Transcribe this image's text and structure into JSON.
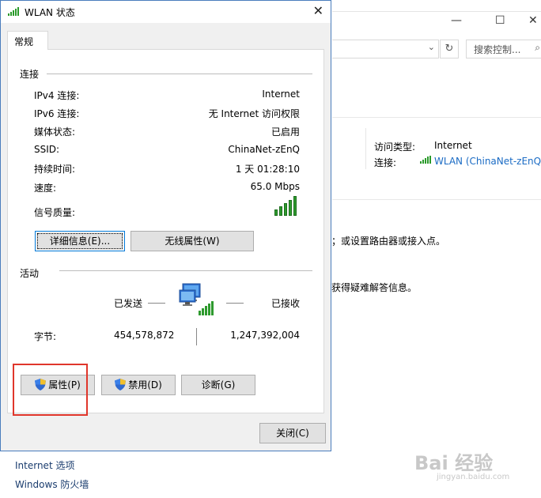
{
  "background": {
    "address_dropdown": "⌄",
    "refresh_icon": "↻",
    "search_placeholder": "搜索控制...",
    "access_type_label": "访问类型:",
    "access_type_value": "Internet",
    "connection_label": "连接:",
    "connection_value": "WLAN (ChinaNet-zEnQ)",
    "line1": "；或设置路由器或接入点。",
    "line2": "获得疑难解答信息。",
    "left_links": [
      "Internet 选项",
      "Windows 防火墙"
    ],
    "watermark": "Bai 经验",
    "watermark_sub": "jingyan.baidu.com"
  },
  "dialog": {
    "title": "WLAN 状态",
    "close_glyph": "✕",
    "tab": "常规",
    "connection_group": "连接",
    "rows": [
      {
        "label": "IPv4 连接:",
        "value": "Internet"
      },
      {
        "label": "IPv6 连接:",
        "value": "无 Internet 访问权限"
      },
      {
        "label": "媒体状态:",
        "value": "已启用"
      },
      {
        "label": "SSID:",
        "value": "ChinaNet-zEnQ"
      },
      {
        "label": "持续时间:",
        "value": "1 天 01:28:10"
      },
      {
        "label": "速度:",
        "value": "65.0 Mbps"
      }
    ],
    "signal_label": "信号质量:",
    "signal_bars": 5,
    "details_button": "详细信息(E)...",
    "wireless_props_button": "无线属性(W)",
    "activity_group": "活动",
    "sent_label": "已发送",
    "received_label": "已接收",
    "bytes_label": "字节:",
    "bytes_sent": "454,578,872",
    "bytes_received": "1,247,392,004",
    "properties_button": "属性(P)",
    "disable_button": "禁用(D)",
    "diagnose_button": "诊断(G)",
    "close_button": "关闭(C)"
  },
  "colors": {
    "accent": "#0078d7",
    "highlight_box": "#e0362b",
    "signal_green": "#2e9a2e",
    "link": "#1a6bc4"
  }
}
